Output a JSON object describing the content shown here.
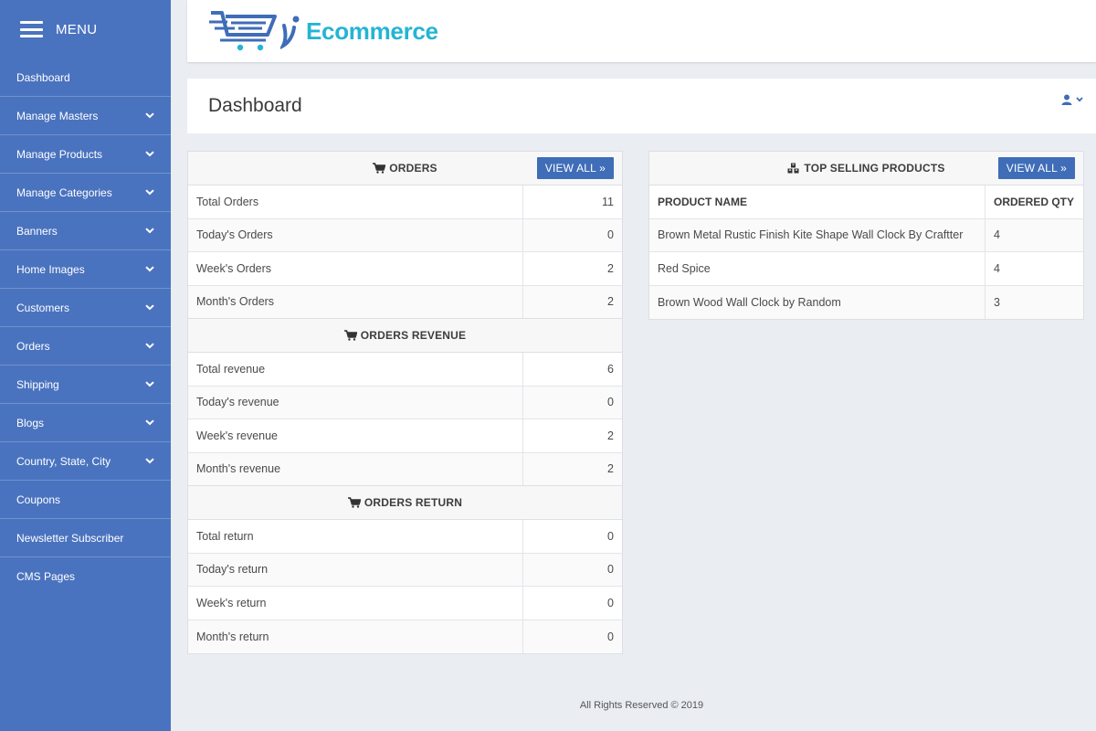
{
  "sidebar": {
    "menu_label": "MENU",
    "items": [
      {
        "label": "Dashboard",
        "chevron": false
      },
      {
        "label": "Manage Masters",
        "chevron": true
      },
      {
        "label": "Manage Products",
        "chevron": true
      },
      {
        "label": "Manage Categories",
        "chevron": true
      },
      {
        "label": "Banners",
        "chevron": true
      },
      {
        "label": "Home Images",
        "chevron": true
      },
      {
        "label": "Customers",
        "chevron": true
      },
      {
        "label": "Orders",
        "chevron": true
      },
      {
        "label": "Shipping",
        "chevron": true
      },
      {
        "label": "Blogs",
        "chevron": true
      },
      {
        "label": "Country, State, City",
        "chevron": true
      },
      {
        "label": "Coupons",
        "chevron": false
      },
      {
        "label": "Newsletter Subscriber",
        "chevron": false
      },
      {
        "label": "CMS Pages",
        "chevron": false
      }
    ]
  },
  "header": {
    "logo_text": "Ecommerce"
  },
  "page": {
    "title": "Dashboard"
  },
  "orders_panel": {
    "orders": {
      "title": "ORDERS",
      "view_all": "VIEW ALL »",
      "rows": [
        {
          "label": "Total Orders",
          "value": "11"
        },
        {
          "label": "Today's Orders",
          "value": "0"
        },
        {
          "label": "Week's Orders",
          "value": "2"
        },
        {
          "label": "Month's Orders",
          "value": "2"
        }
      ]
    },
    "revenue": {
      "title": "ORDERS REVENUE",
      "rows": [
        {
          "label": "Total revenue",
          "value": "6"
        },
        {
          "label": "Today's revenue",
          "value": "0"
        },
        {
          "label": "Week's revenue",
          "value": "2"
        },
        {
          "label": "Month's revenue",
          "value": "2"
        }
      ]
    },
    "returns": {
      "title": "ORDERS RETURN",
      "rows": [
        {
          "label": "Total return",
          "value": "0"
        },
        {
          "label": "Today's return",
          "value": "0"
        },
        {
          "label": "Week's return",
          "value": "0"
        },
        {
          "label": "Month's return",
          "value": "0"
        }
      ]
    }
  },
  "top_selling": {
    "title": "TOP SELLING PRODUCTS",
    "view_all": "VIEW ALL »",
    "columns": [
      "PRODUCT NAME",
      "ORDERED QTY"
    ],
    "rows": [
      {
        "name": "Brown Metal Rustic Finish Kite Shape Wall Clock By Craftter",
        "qty": "4"
      },
      {
        "name": "Red Spice",
        "qty": "4"
      },
      {
        "name": "Brown Wood Wall Clock by Random",
        "qty": "3"
      }
    ]
  },
  "footer": {
    "text": "All Rights Reserved © 2019"
  },
  "colors": {
    "sidebar_bg": "#4a73bf",
    "button_bg": "#3f6db8",
    "logo_accent": "#25b4d4",
    "page_bg": "#eaedf2"
  }
}
